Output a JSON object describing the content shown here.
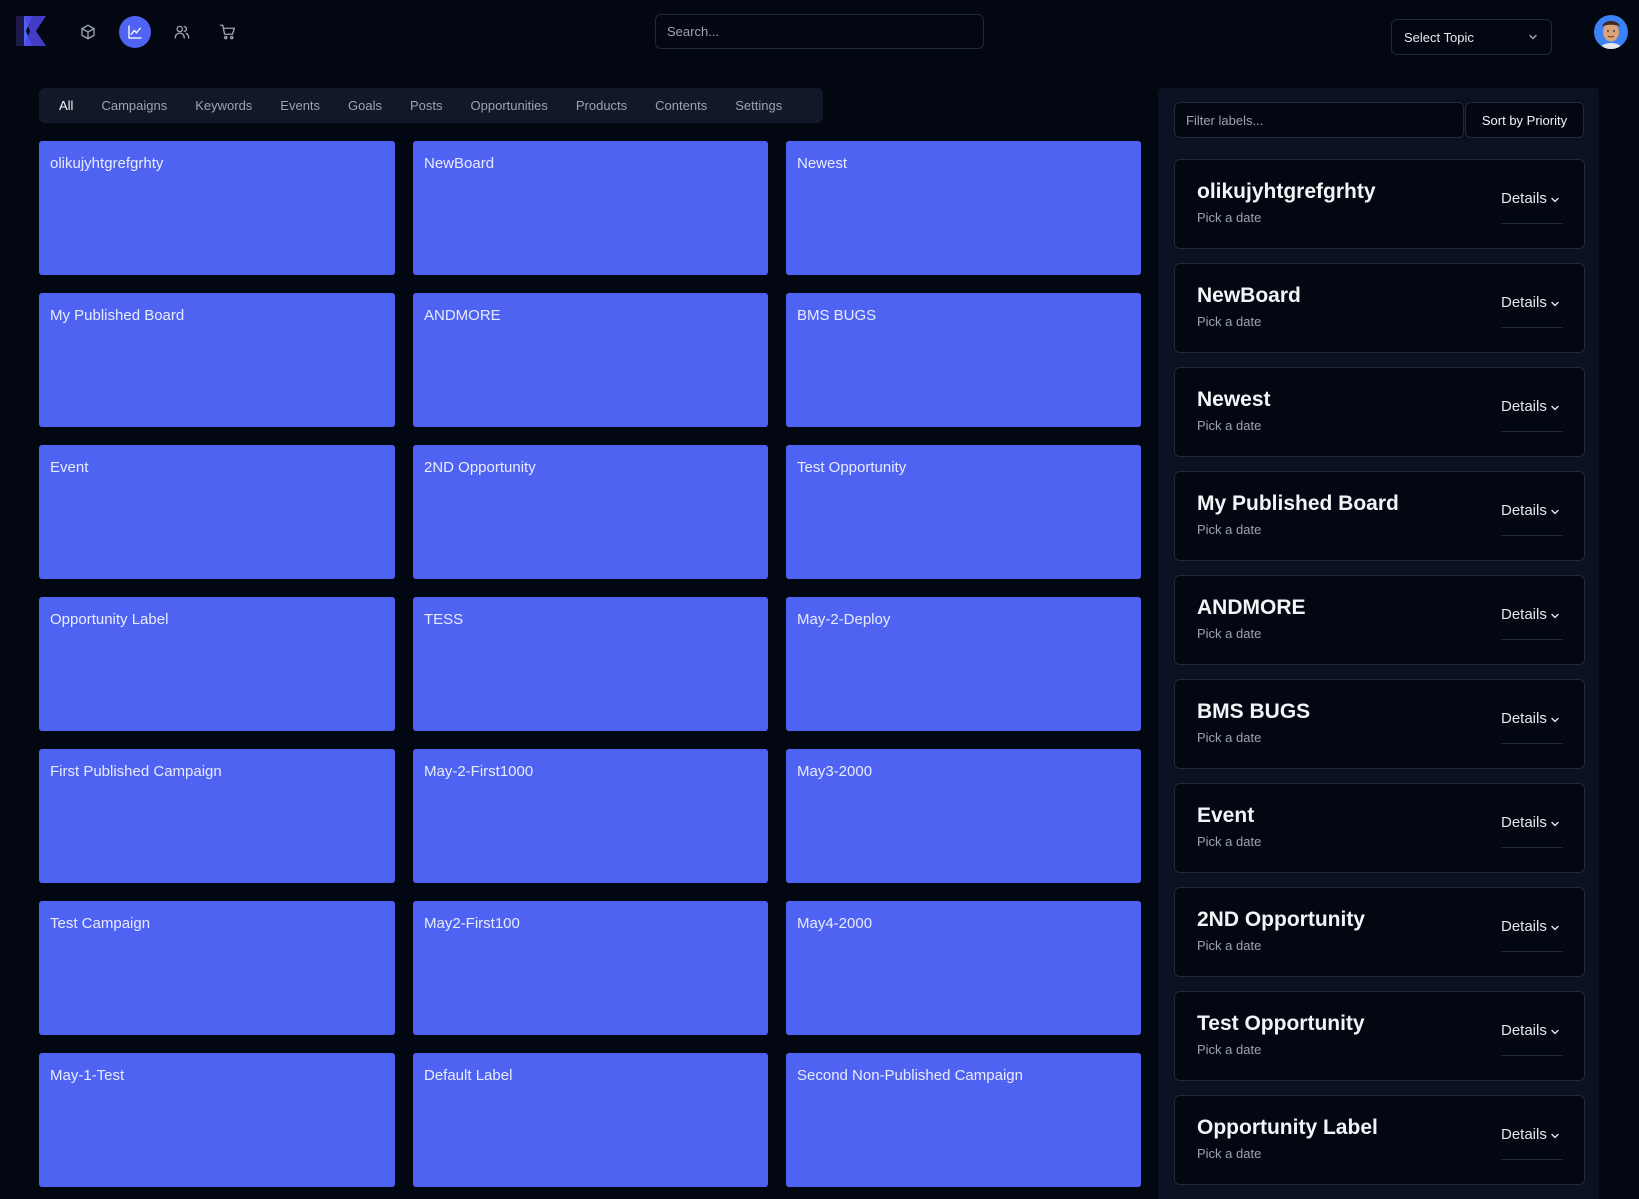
{
  "colors": {
    "background": "#030712",
    "accent": "#4f63f2",
    "card_text": "#e8ebff",
    "muted_text": "#9ca3af"
  },
  "header": {
    "nav_icons": [
      "box-icon",
      "chart-icon",
      "users-icon",
      "cart-icon"
    ],
    "active_nav": "chart-icon",
    "search": {
      "placeholder": "Search...",
      "value": ""
    },
    "topic_select": {
      "label": "Select Topic"
    }
  },
  "tabs": [
    {
      "label": "All",
      "active": true
    },
    {
      "label": "Campaigns",
      "active": false
    },
    {
      "label": "Keywords",
      "active": false
    },
    {
      "label": "Events",
      "active": false
    },
    {
      "label": "Goals",
      "active": false
    },
    {
      "label": "Posts",
      "active": false
    },
    {
      "label": "Opportunities",
      "active": false
    },
    {
      "label": "Products",
      "active": false
    },
    {
      "label": "Contents",
      "active": false
    },
    {
      "label": "Settings",
      "active": false
    }
  ],
  "boards": [
    "olikujyhtgrefgrhty",
    "NewBoard",
    "Newest",
    "My Published Board",
    "ANDMORE",
    "BMS BUGS",
    "Event",
    "2ND Opportunity",
    "Test Opportunity",
    "Opportunity Label",
    "TESS",
    "May-2-Deploy",
    "First Published Campaign",
    "May-2-First1000",
    "May3-2000",
    "Test Campaign",
    "May2-First100",
    "May4-2000",
    "May-1-Test",
    "Default Label",
    "Second Non-Published Campaign"
  ],
  "panel": {
    "filter": {
      "placeholder": "Filter labels...",
      "value": ""
    },
    "sort_label": "Sort by Priority",
    "labels": [
      {
        "title": "olikujyhtgrefgrhty",
        "subtitle": "Pick a date",
        "details": "Details"
      },
      {
        "title": "NewBoard",
        "subtitle": "Pick a date",
        "details": "Details"
      },
      {
        "title": "Newest",
        "subtitle": "Pick a date",
        "details": "Details"
      },
      {
        "title": "My Published Board",
        "subtitle": "Pick a date",
        "details": "Details"
      },
      {
        "title": "ANDMORE",
        "subtitle": "Pick a date",
        "details": "Details"
      },
      {
        "title": "BMS BUGS",
        "subtitle": "Pick a date",
        "details": "Details"
      },
      {
        "title": "Event",
        "subtitle": "Pick a date",
        "details": "Details"
      },
      {
        "title": "2ND Opportunity",
        "subtitle": "Pick a date",
        "details": "Details"
      },
      {
        "title": "Test Opportunity",
        "subtitle": "Pick a date",
        "details": "Details"
      },
      {
        "title": "Opportunity Label",
        "subtitle": "Pick a date",
        "details": "Details"
      }
    ]
  }
}
